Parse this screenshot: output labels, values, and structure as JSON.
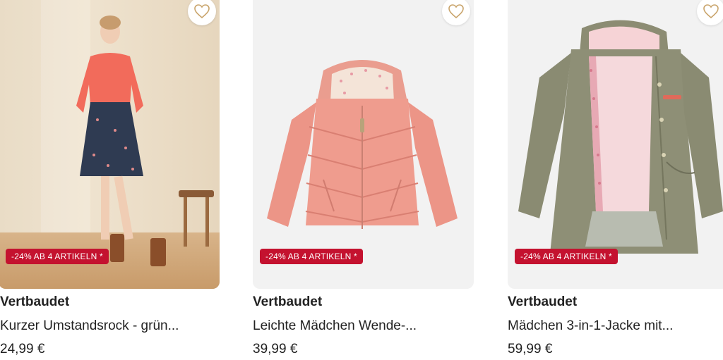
{
  "products": [
    {
      "brand": "Vertbaudet",
      "title": "Kurzer Umstandsrock - grün...",
      "price": "24,99 €",
      "badge": "-24% AB 4 ARTIKELN *",
      "image": "model-wearing-floral-skirt-and-coral-sweater"
    },
    {
      "brand": "Vertbaudet",
      "title": "Leichte Mädchen Wende-...",
      "price": "39,99 €",
      "badge": "-24% AB 4 ARTIKELN *",
      "image": "pink-quilted-hooded-jacket"
    },
    {
      "brand": "Vertbaudet",
      "title": "Mädchen 3-in-1-Jacke mit...",
      "price": "59,99 €",
      "badge": "-24% AB 4 ARTIKELN *",
      "image": "khaki-parka-with-pink-lining"
    }
  ],
  "colors": {
    "badge_bg": "#c4122f",
    "badge_text": "#ffffff",
    "heart_stroke": "#c9a46b",
    "text": "#222222"
  },
  "icons": {
    "favorite": "heart-outline-icon"
  }
}
